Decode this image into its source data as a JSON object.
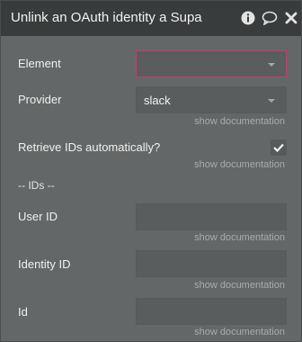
{
  "header": {
    "title": "Unlink an OAuth identity a Supa",
    "icons": [
      "info-icon",
      "comment-icon",
      "close-icon"
    ]
  },
  "fields": {
    "element": {
      "label": "Element",
      "value": ""
    },
    "provider": {
      "label": "Provider",
      "value": "slack",
      "doc_link": "show documentation"
    },
    "retrieve": {
      "label": "Retrieve IDs automatically?",
      "checked": true,
      "doc_link": "show documentation"
    },
    "section_label": "-- IDs --",
    "user_id": {
      "label": "User ID",
      "value": "",
      "doc_link": "show documentation"
    },
    "identity_id": {
      "label": "Identity ID",
      "value": "",
      "doc_link": "show documentation"
    },
    "id": {
      "label": "Id",
      "value": "",
      "doc_link": "show documentation"
    }
  },
  "colors": {
    "panel": "#646767",
    "header": "#393c3c",
    "accent_border": "#c2406a"
  }
}
